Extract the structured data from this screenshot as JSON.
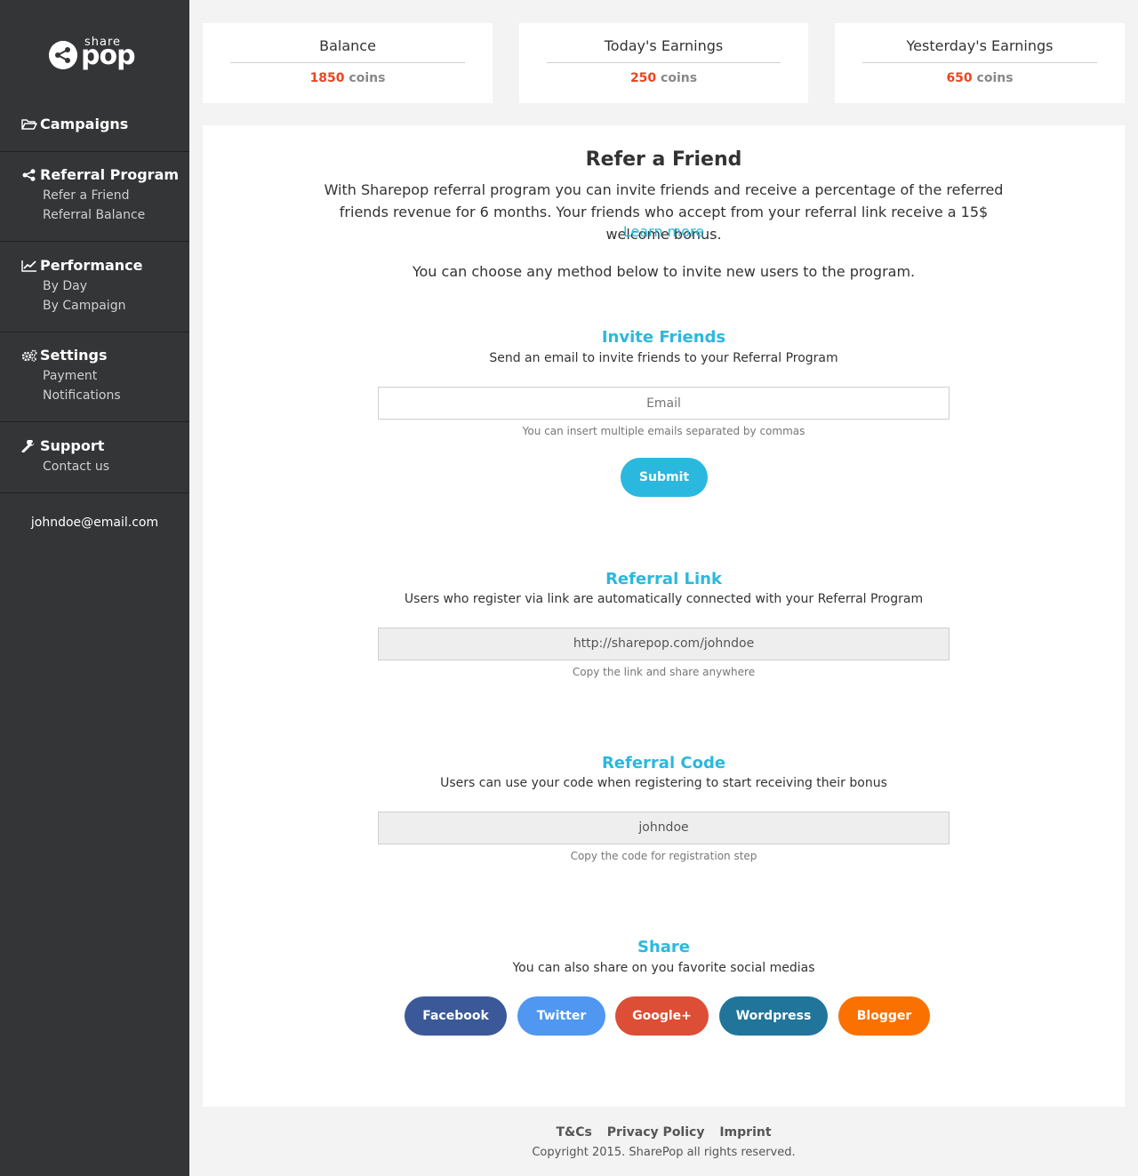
{
  "brand": {
    "small": "share",
    "large": "pop"
  },
  "sidebar": {
    "sections": [
      {
        "icon": "folder-icon",
        "label": "Campaigns",
        "items": []
      },
      {
        "icon": "share-icon",
        "label": "Referral Program",
        "items": [
          "Refer a Friend",
          "Referral Balance"
        ]
      },
      {
        "icon": "line-chart-icon",
        "label": "Performance",
        "items": [
          "By Day",
          "By Campaign"
        ]
      },
      {
        "icon": "gears-icon",
        "label": "Settings",
        "items": [
          "Payment",
          "Notifications"
        ]
      },
      {
        "icon": "wrench-icon",
        "label": "Support",
        "items": [
          "Contact us"
        ]
      }
    ],
    "user_email": "johndoe@email.com"
  },
  "stats": [
    {
      "label": "Balance",
      "value": "1850",
      "unit": "coins"
    },
    {
      "label": "Today's Earnings",
      "value": "250",
      "unit": "coins"
    },
    {
      "label": "Yesterday's Earnings",
      "value": "650",
      "unit": "coins"
    }
  ],
  "main": {
    "title": "Refer a Friend",
    "intro": "With Sharepop referral program you can invite friends and receive a percentage of the referred friends revenue for 6 months. Your friends who accept from your referral link receive a 15$ welcome bonus.",
    "learn_more": "Learn more",
    "choose_text": "You can choose any method below to invite new users to the program.",
    "invite": {
      "title": "Invite Friends",
      "description": "Send an email to invite friends to your Referral Program",
      "email_placeholder": "Email",
      "email_value": "",
      "hint": "You can insert multiple emails separated by commas",
      "submit_label": "Submit"
    },
    "referral_link": {
      "title": "Referral Link",
      "description": "Users who register via link are automatically connected with your Referral Program",
      "value": "http://sharepop.com/johndoe",
      "hint": "Copy the link and share anywhere"
    },
    "referral_code": {
      "title": "Referral Code",
      "description": "Users can use your code when registering to start receiving their bonus",
      "value": "johndoe",
      "hint": "Copy the code for registration step"
    },
    "share": {
      "title": "Share",
      "description": "You can also share on you favorite social medias",
      "buttons": [
        {
          "label": "Facebook",
          "color": "#3b5998"
        },
        {
          "label": "Twitter",
          "color": "#4f97f0"
        },
        {
          "label": "Google+",
          "color": "#dc4e35"
        },
        {
          "label": "Wordpress",
          "color": "#21759b"
        },
        {
          "label": "Blogger",
          "color": "#fb7100"
        }
      ]
    }
  },
  "footer": {
    "links": [
      "T&Cs",
      "Privacy Policy",
      "Imprint"
    ],
    "copyright": "Copyright 2015. SharePop all rights reserved."
  },
  "colors": {
    "accent": "#2bb8de",
    "sidebar_bg": "#343537",
    "highlight_number": "#e8461e"
  }
}
